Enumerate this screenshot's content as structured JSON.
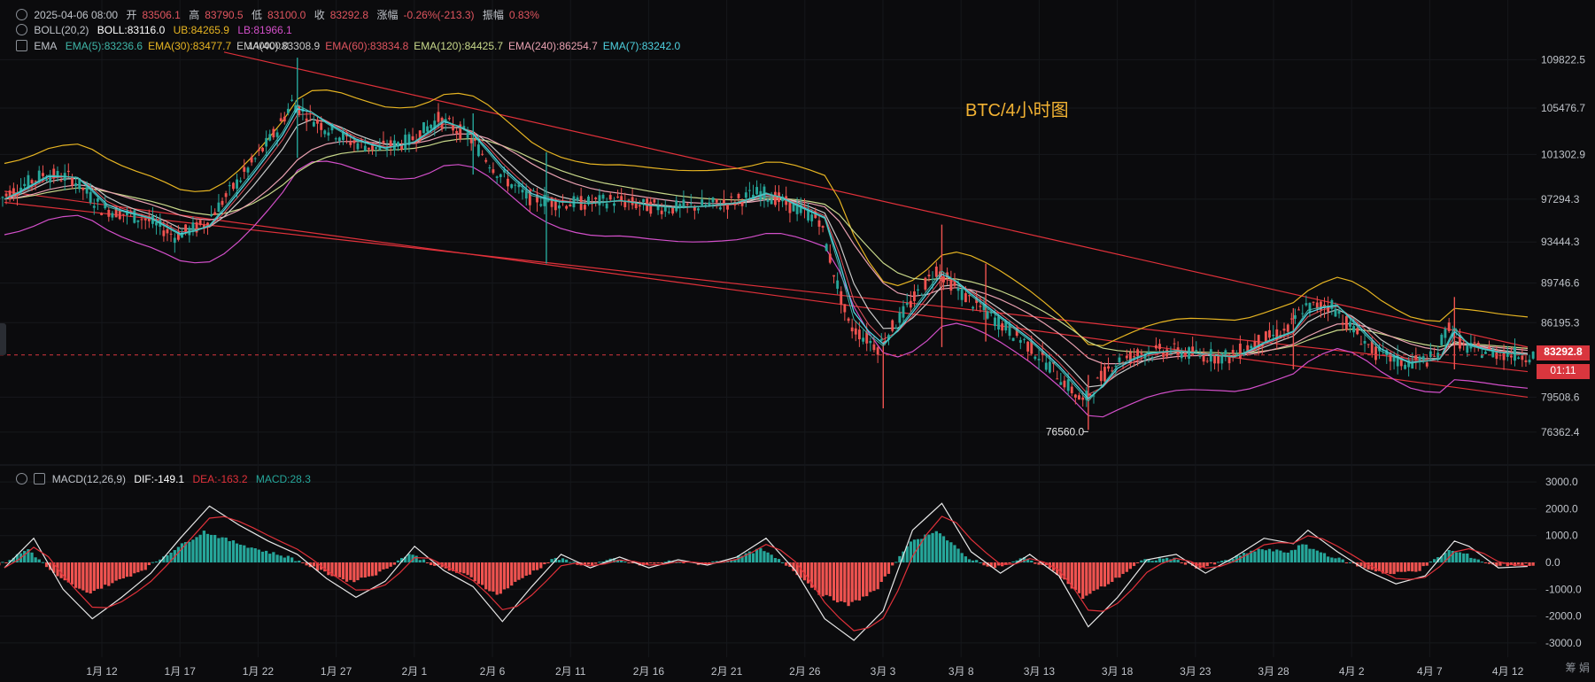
{
  "header": {
    "line1": {
      "datetime": "2025-04-06 08:00",
      "open_label": "开",
      "open": "83506.1",
      "high_label": "高",
      "high": "83790.5",
      "low_label": "低",
      "low": "83100.0",
      "close_label": "收",
      "close": "83292.8",
      "change_label": "涨幅",
      "change": "-0.26%(-213.3)",
      "amplitude_label": "振幅",
      "amplitude": "0.83%"
    },
    "boll": {
      "name": "BOLL(20,2)",
      "mid": "BOLL:83116.0",
      "ub": "UB:84265.9",
      "lb": "LB:81966.1"
    },
    "ema": {
      "name": "EMA",
      "items": [
        {
          "text": "EMA(5):83236.6",
          "color": "#3fb6a8"
        },
        {
          "text": "EMA(30):83477.7",
          "color": "#e6b422"
        },
        {
          "text": "EMA(40):83308.9",
          "color": "#c9c9c9"
        },
        {
          "text": "EMA(60):83834.8",
          "color": "#e0555f"
        },
        {
          "text": "EMA(120):84425.7",
          "color": "#c8d88a"
        },
        {
          "text": "EMA(240):86254.7",
          "color": "#e8a0b0"
        },
        {
          "text": "EMA(7):83242.0",
          "color": "#4fd1e0"
        }
      ],
      "overlap_label": "140000.0"
    },
    "macd": {
      "name": "MACD(12,26,9)",
      "dif": "DIF:-149.1",
      "dea": "DEA:-163.2",
      "macd": "MACD:28.3"
    }
  },
  "annotation": {
    "title": "BTC/4小时图",
    "low_marker": "76560.0"
  },
  "price_tag": {
    "price": "83292.8",
    "countdown": "01:11"
  },
  "corner_label": "筹 娟",
  "colors": {
    "up": "#26a69a",
    "down": "#ef5350",
    "trend": "#e0313a",
    "boll_upper": "#e6b422",
    "boll_lower": "#d24fc9",
    "dif": "#e8e8e8",
    "dea": "#e0313a"
  },
  "chart_data": {
    "type": "candlestick",
    "interval": "4h",
    "price_axis": {
      "ticks": [
        109822.5,
        105476.7,
        101302.9,
        97294.3,
        93444.3,
        89746.6,
        86195.3,
        79508.6,
        76362.4
      ],
      "ylim": [
        75000,
        112000
      ]
    },
    "macd_axis": {
      "ticks": [
        3000.0,
        2000.0,
        1000.0,
        0.0,
        -1000.0,
        -2000.0,
        -3000.0
      ],
      "tick_labels": [
        "3000.0",
        "2000.0",
        "1000.0",
        "0.0",
        "-1000.0",
        "-2000.0",
        "-3000.0"
      ],
      "ylim": [
        -3300,
        3300
      ]
    },
    "x_axis": {
      "tick_labels": [
        "1月 12",
        "1月 17",
        "1月 22",
        "1月 27",
        "2月 1",
        "2月 6",
        "2月 11",
        "2月 16",
        "2月 21",
        "2月 26",
        "3月 3",
        "3月 8",
        "3月 13",
        "3月 18",
        "3月 23",
        "3月 28",
        "4月 2",
        "4月 7",
        "4月 12"
      ]
    },
    "price_path": [
      [
        0,
        97300
      ],
      [
        3,
        99500
      ],
      [
        5,
        99200
      ],
      [
        7,
        96500
      ],
      [
        10,
        95500
      ],
      [
        12,
        94000
      ],
      [
        14,
        95000
      ],
      [
        17,
        100000
      ],
      [
        19,
        103500
      ],
      [
        20,
        106000
      ],
      [
        22,
        104000
      ],
      [
        24,
        102500
      ],
      [
        26,
        101800
      ],
      [
        28,
        102500
      ],
      [
        30,
        104500
      ],
      [
        32,
        103000
      ],
      [
        34,
        99800
      ],
      [
        36,
        97500
      ],
      [
        38,
        97000
      ],
      [
        40,
        96900
      ],
      [
        42,
        97200
      ],
      [
        44,
        96700
      ],
      [
        46,
        96500
      ],
      [
        48,
        96700
      ],
      [
        50,
        97000
      ],
      [
        52,
        97900
      ],
      [
        53,
        97400
      ],
      [
        54,
        96700
      ],
      [
        56,
        95500
      ],
      [
        58,
        86000
      ],
      [
        60,
        84000
      ],
      [
        62,
        87500
      ],
      [
        64,
        91000
      ],
      [
        66,
        88500
      ],
      [
        68,
        86500
      ],
      [
        70,
        84500
      ],
      [
        72,
        82000
      ],
      [
        74,
        79000
      ],
      [
        76,
        82500
      ],
      [
        78,
        83500
      ],
      [
        80,
        83700
      ],
      [
        82,
        83300
      ],
      [
        84,
        83100
      ],
      [
        86,
        84500
      ],
      [
        88,
        85500
      ],
      [
        89,
        87500
      ],
      [
        91,
        87800
      ],
      [
        92,
        86200
      ],
      [
        94,
        83500
      ],
      [
        96,
        82500
      ],
      [
        98,
        83000
      ],
      [
        99,
        86000
      ],
      [
        100,
        84000
      ],
      [
        102,
        83500
      ],
      [
        104,
        83300
      ]
    ],
    "swing_points": [
      [
        20,
        110000,
        101000
      ],
      [
        32,
        105000,
        99500
      ],
      [
        37,
        101500,
        91500
      ],
      [
        60,
        84500,
        78500
      ],
      [
        64,
        95000,
        84000
      ],
      [
        67,
        91500,
        84500
      ],
      [
        74,
        81500,
        76560
      ],
      [
        88,
        87500,
        82000
      ],
      [
        99,
        88500,
        82000
      ]
    ],
    "macd_path": [
      [
        0,
        -200
      ],
      [
        2,
        900
      ],
      [
        4,
        -1000
      ],
      [
        6,
        -2100
      ],
      [
        8,
        -1300
      ],
      [
        10,
        -400
      ],
      [
        12,
        900
      ],
      [
        14,
        2100
      ],
      [
        16,
        1400
      ],
      [
        18,
        800
      ],
      [
        20,
        300
      ],
      [
        22,
        -600
      ],
      [
        24,
        -1300
      ],
      [
        26,
        -700
      ],
      [
        28,
        600
      ],
      [
        30,
        -300
      ],
      [
        32,
        -900
      ],
      [
        34,
        -2200
      ],
      [
        36,
        -900
      ],
      [
        38,
        300
      ],
      [
        40,
        -200
      ],
      [
        42,
        200
      ],
      [
        44,
        -200
      ],
      [
        46,
        100
      ],
      [
        48,
        -100
      ],
      [
        50,
        200
      ],
      [
        52,
        900
      ],
      [
        54,
        -300
      ],
      [
        56,
        -2100
      ],
      [
        58,
        -2900
      ],
      [
        60,
        -1800
      ],
      [
        62,
        1200
      ],
      [
        64,
        2200
      ],
      [
        66,
        400
      ],
      [
        68,
        -400
      ],
      [
        70,
        300
      ],
      [
        72,
        -500
      ],
      [
        74,
        -2400
      ],
      [
        76,
        -1300
      ],
      [
        78,
        100
      ],
      [
        80,
        300
      ],
      [
        82,
        -400
      ],
      [
        84,
        200
      ],
      [
        86,
        900
      ],
      [
        88,
        700
      ],
      [
        89,
        1200
      ],
      [
        91,
        400
      ],
      [
        93,
        -300
      ],
      [
        95,
        -800
      ],
      [
        97,
        -500
      ],
      [
        99,
        800
      ],
      [
        100,
        600
      ],
      [
        102,
        -200
      ],
      [
        104,
        -150
      ]
    ],
    "trendlines": [
      {
        "x0": 0,
        "y0": 98000,
        "x1": 104,
        "y1": 79500
      },
      {
        "x0": 15,
        "y0": 110500,
        "x1": 104,
        "y1": 84000
      },
      {
        "x0": 0,
        "y0": 97000,
        "x1": 104,
        "y1": 81800
      }
    ],
    "y_ranges_note": "values estimated from axis ticks"
  }
}
